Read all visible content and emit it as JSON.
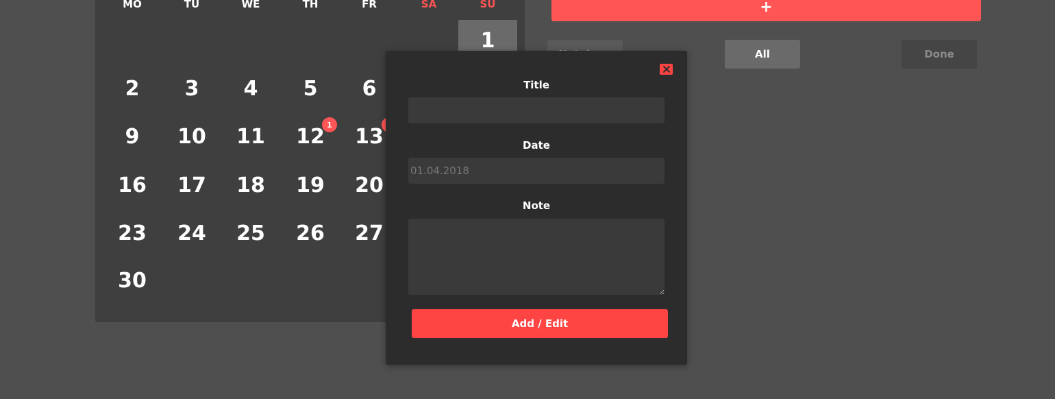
{
  "calendar": {
    "weekdays": [
      "MO",
      "TU",
      "WE",
      "TH",
      "FR",
      "SA",
      "SU"
    ],
    "selected_day": "1",
    "days": {
      "d1": "1",
      "d2": "2",
      "d3": "3",
      "d4": "4",
      "d5": "5",
      "d6": "6",
      "d9": "9",
      "d10": "10",
      "d11": "11",
      "d12": "12",
      "d13": "13",
      "d16": "16",
      "d17": "17",
      "d18": "18",
      "d19": "19",
      "d20": "20",
      "d23": "23",
      "d24": "24",
      "d25": "25",
      "d26": "26",
      "d27": "27",
      "d30": "30"
    },
    "badges": {
      "d12": "1"
    }
  },
  "filters": {
    "not_done_label": "Not done",
    "all_label": "All",
    "done_label": "Done"
  },
  "modal": {
    "title_label": "Title",
    "title_value": "",
    "date_label": "Date",
    "date_placeholder": "01.04.2018",
    "note_label": "Note",
    "note_value": "",
    "submit_label": "Add / Edit"
  },
  "colors": {
    "accent": "#ff5555",
    "background": "#4f4f4f",
    "calendar_bg": "#3f3f3f",
    "modal_bg": "#2c2c2c"
  },
  "icons": {
    "close": "close-icon",
    "add": "plus-icon"
  }
}
